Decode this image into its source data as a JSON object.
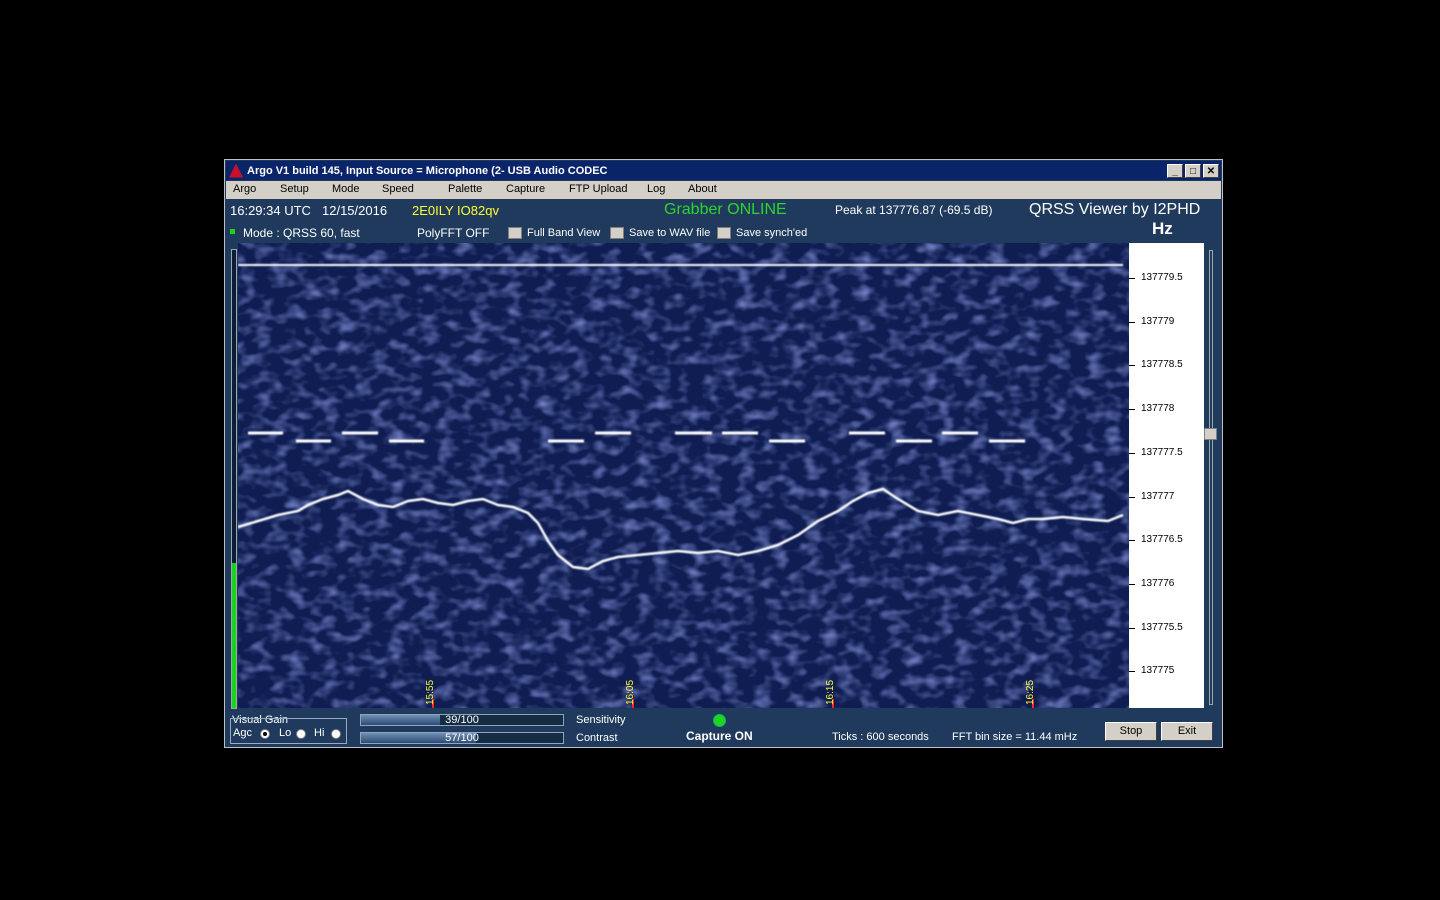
{
  "window": {
    "title": "Argo V1 build 145, Input Source = Microphone (2- USB Audio CODEC",
    "controls": {
      "minimize": "_",
      "maximize": "□",
      "close": "✕"
    }
  },
  "menu": [
    "Argo",
    "Setup",
    "Mode",
    "Speed",
    "Palette",
    "Capture",
    "FTP Upload",
    "Log",
    "About"
  ],
  "status": {
    "time": "16:29:34 UTC",
    "date": "12/15/2016",
    "callsign": "2E0ILY IO82qv",
    "grabber": "Grabber ONLINE",
    "peak": "Peak at  137776.87 (-69.5 dB)",
    "brand": "QRSS Viewer by I2PHD",
    "unit": "Hz",
    "mode": "Mode : QRSS 60, fast",
    "polyfft": "PolyFFT OFF",
    "full_band": "Full Band View",
    "save_wav": "Save to WAV file",
    "save_sync": "Save synch'ed"
  },
  "freq_scale": [
    "137779.5",
    "137779",
    "137778.5",
    "137778",
    "137777.5",
    "137777",
    "137776.5",
    "137776",
    "137775.5",
    "137775"
  ],
  "time_ticks": [
    "15:55",
    "16:05",
    "16:15",
    "16:25"
  ],
  "bottom": {
    "visual_gain": "Visual Gain",
    "agc": "Agc",
    "lo": "Lo",
    "hi": "Hi",
    "sensitivity_text": "39/100",
    "sensitivity_value": 39,
    "sensitivity_label": "Sensitivity",
    "contrast_text": "57/100",
    "contrast_value": 57,
    "contrast_label": "Contrast",
    "capture": "Capture ON",
    "ticks": "Ticks   : 600 seconds",
    "fft_bin": "FFT bin size = 11.44 mHz",
    "stop": "Stop",
    "exit": "Exit"
  },
  "colors": {
    "waterfall": "#0f1d52",
    "grabber": "#2ed42e",
    "callsign": "#ffff33",
    "agc_bar": "#1fd11f"
  }
}
